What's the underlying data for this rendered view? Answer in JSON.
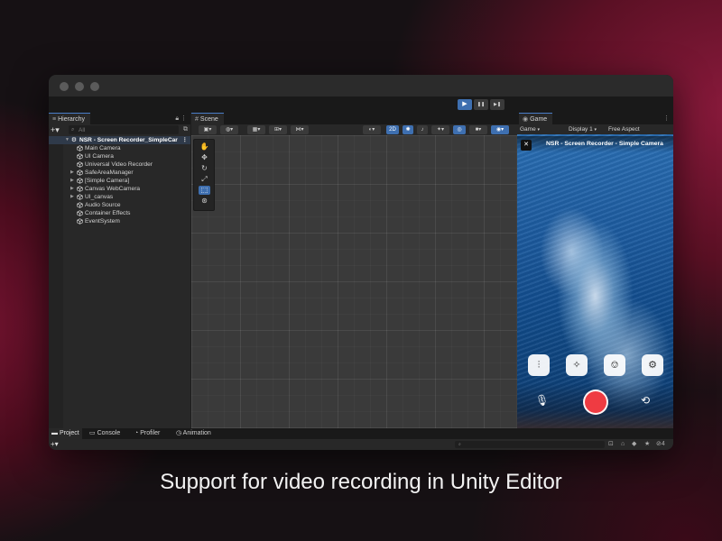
{
  "caption": "Support for video recording in Unity Editor",
  "toolbar": {
    "play_icon": "▶",
    "pause_icon": "❚❚",
    "step_icon": "▶❚"
  },
  "hierarchy": {
    "tab_label": "Hierarchy",
    "search_placeholder": "All",
    "root": "NSR - Screen Recorder_SimpleCar",
    "items": [
      {
        "label": "Main Camera",
        "expandable": false
      },
      {
        "label": "UI Camera",
        "expandable": false
      },
      {
        "label": "Universal Video Recorder",
        "expandable": false
      },
      {
        "label": "SafeAreaManager",
        "expandable": true
      },
      {
        "label": "[Simple Camera]",
        "expandable": true
      },
      {
        "label": "Canvas WebCamera",
        "expandable": true
      },
      {
        "label": "UI_canvas",
        "expandable": true
      },
      {
        "label": "Audio Source",
        "expandable": false
      },
      {
        "label": "Container Effects",
        "expandable": false
      },
      {
        "label": "EventSystem",
        "expandable": false
      }
    ]
  },
  "scene": {
    "tab_label": "Scene",
    "mode_2d_label": "2D"
  },
  "game": {
    "tab_label": "Game",
    "view_select": "Game",
    "display_select": "Display 1",
    "aspect_select": "Free Aspect",
    "title": "NSR - Screen Recorder - Simple Camera"
  },
  "bottom": {
    "tabs": [
      "Project",
      "Console",
      "Profiler",
      "Animation"
    ],
    "badge": "4"
  },
  "colors": {
    "accent": "#3e6fb0",
    "record": "#ef3b42"
  }
}
